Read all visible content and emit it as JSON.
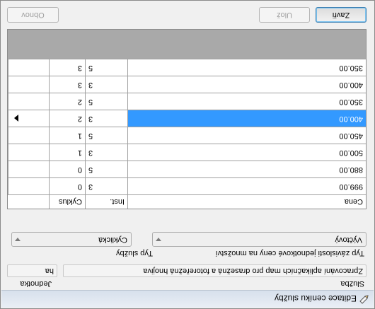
{
  "window": {
    "title": "Editace ceníku služby"
  },
  "form": {
    "service_label": "Služba",
    "service_value": "Zpracování aplikačních map pro drasežná a fotoreřežná hnojiva",
    "unit_label": "Jednotka",
    "unit_value": "ha",
    "service_type_label": "Typ služby",
    "service_type_value": "Cyklická",
    "dependency_label": "Typ závislosti jednotkové ceny na množství",
    "dependency_value": "Výčtový"
  },
  "grid": {
    "columns": [
      "Cyklus",
      "Inst.",
      "Cena"
    ],
    "rows": [
      {
        "cyklus": "0",
        "inst": "3",
        "cena": "999.00",
        "selected": false
      },
      {
        "cyklus": "0",
        "inst": "5",
        "cena": "880.00",
        "selected": false
      },
      {
        "cyklus": "1",
        "inst": "3",
        "cena": "500.00",
        "selected": false
      },
      {
        "cyklus": "1",
        "inst": "5",
        "cena": "450.00",
        "selected": false
      },
      {
        "cyklus": "2",
        "inst": "3",
        "cena": "400.00",
        "selected": true
      },
      {
        "cyklus": "2",
        "inst": "5",
        "cena": "350.00",
        "selected": false
      },
      {
        "cyklus": "3",
        "inst": "3",
        "cena": "400.00",
        "selected": false
      },
      {
        "cyklus": "3",
        "inst": "5",
        "cena": "350.00",
        "selected": false
      }
    ]
  },
  "buttons": {
    "close": "Zavři",
    "save": "Ulož",
    "refresh": "Obnov"
  },
  "icons": {
    "title": "edit-pencil-icon",
    "row_pointer": "current-row-pointer-icon",
    "dropdown": "chevron-down-icon"
  }
}
